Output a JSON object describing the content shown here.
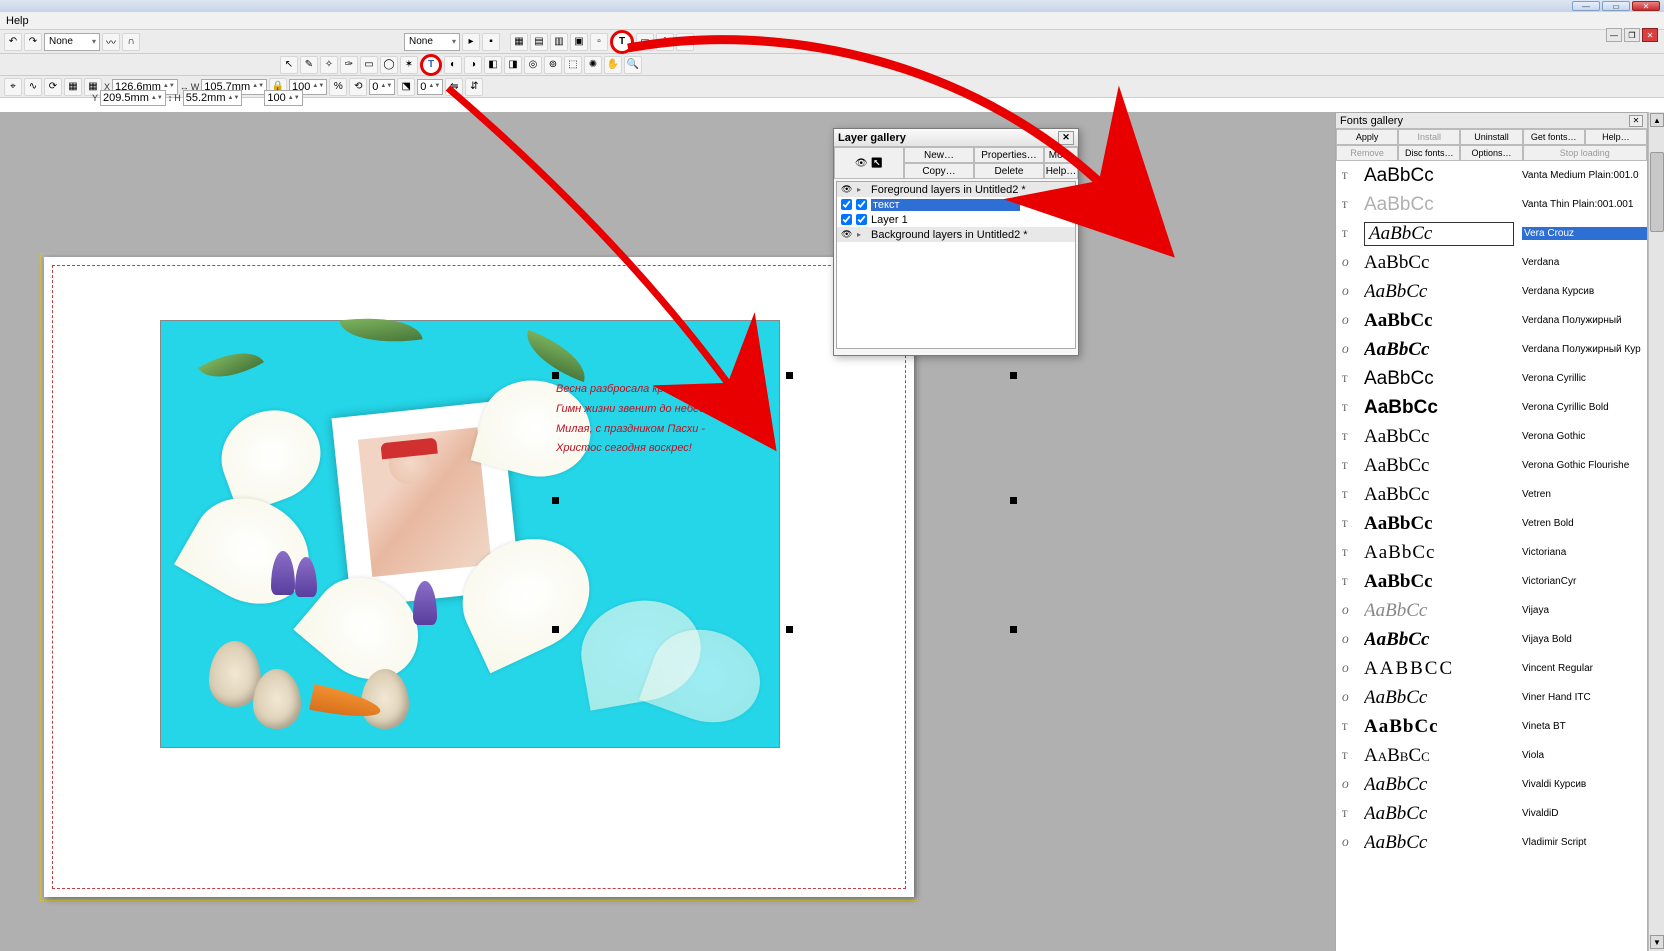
{
  "window": {
    "title": " "
  },
  "menubar": {
    "help": "Help"
  },
  "toolbar1": {
    "none1": "None",
    "none2": "None"
  },
  "geom": {
    "x_label": "X",
    "y_label": "Y",
    "w_label": "W",
    "h_label": "H",
    "x": "126.6mm",
    "y": "209.5mm",
    "w": "105.7mm",
    "h": "55.2mm",
    "pct1": "100",
    "pct2": "100",
    "angle": "0",
    "skew": "0"
  },
  "poem": {
    "l1": "Весна разбросала краски,",
    "l2": "Гимн жизни звенит до небес,",
    "l3": "Милая, с праздником Пасхи -",
    "l4": "Христос сегодня воскрес!"
  },
  "layer_gallery": {
    "title": "Layer gallery",
    "buttons": {
      "new": "New…",
      "properties": "Properties…",
      "move": "Move",
      "copy": "Copy…",
      "delete": "Delete",
      "help": "Help…"
    },
    "rows": [
      {
        "type": "header",
        "label": "Foreground layers in Untitled2 *"
      },
      {
        "type": "layer",
        "label": "текст",
        "selected": true
      },
      {
        "type": "layer",
        "label": "Layer 1"
      },
      {
        "type": "header",
        "label": "Background layers in Untitled2 *"
      }
    ]
  },
  "fonts_gallery": {
    "title": "Fonts gallery",
    "buttons": {
      "apply": "Apply",
      "install": "Install",
      "uninstall": "Uninstall",
      "getfonts": "Get fonts…",
      "help": "Help…",
      "remove": "Remove",
      "discfonts": "Disc fonts…",
      "options": "Options…",
      "stoploading": "Stop loading"
    },
    "sample": "AaBbCc",
    "fonts": [
      {
        "ico": "T",
        "prev_style": "font-family:Arial;",
        "name": "Vanta Medium Plain:001.0"
      },
      {
        "ico": "T",
        "prev_style": "font-family:Arial;color:#b0b0b0;",
        "name": "Vanta Thin Plain:001.001"
      },
      {
        "ico": "T",
        "prev_style": "font-family:'Brush Script MT',cursive;font-style:italic;",
        "name": "Vera Crouz",
        "selected": true
      },
      {
        "ico": "O",
        "prev_style": "font-family:Verdana;",
        "name": "Verdana"
      },
      {
        "ico": "O",
        "prev_style": "font-family:Verdana;font-style:italic;",
        "name": "Verdana Курсив"
      },
      {
        "ico": "O",
        "prev_style": "font-family:Verdana;font-weight:bold;",
        "name": "Verdana Полужирный"
      },
      {
        "ico": "O",
        "prev_style": "font-family:Verdana;font-weight:bold;font-style:italic;",
        "name": "Verdana Полужирный Кур"
      },
      {
        "ico": "T",
        "prev_style": "font-family:Arial;",
        "name": "Verona Cyrillic"
      },
      {
        "ico": "T",
        "prev_style": "font-family:Arial;font-weight:bold;",
        "name": "Verona Cyrillic Bold"
      },
      {
        "ico": "T",
        "prev_style": "font-family:'Old English Text MT',serif;",
        "name": "Verona Gothic"
      },
      {
        "ico": "T",
        "prev_style": "font-family:'Old English Text MT',serif;",
        "name": "Verona Gothic Flourishe"
      },
      {
        "ico": "T",
        "prev_style": "font-family:'Times New Roman',serif;",
        "name": "Vetren"
      },
      {
        "ico": "T",
        "prev_style": "font-family:'Times New Roman',serif;font-weight:bold;",
        "name": "Vetren Bold"
      },
      {
        "ico": "T",
        "prev_style": "font-family:'Wide Latin',serif;letter-spacing:1px;",
        "name": "Victoriana"
      },
      {
        "ico": "T",
        "prev_style": "font-family:'Cooper Black',serif;font-weight:bold;",
        "name": "VictorianCyr"
      },
      {
        "ico": "O",
        "prev_style": "font-family:Georgia;font-style:italic;color:#888;",
        "name": "Vijaya"
      },
      {
        "ico": "O",
        "prev_style": "font-family:Georgia;font-style:italic;font-weight:bold;",
        "name": "Vijaya Bold"
      },
      {
        "ico": "O",
        "prev_style": "font-family:'Arial Narrow';letter-spacing:2px;text-transform:uppercase;",
        "sample": "AABBCC",
        "name": "Vincent Regular"
      },
      {
        "ico": "O",
        "prev_style": "font-family:'Segoe Script',cursive;font-style:italic;",
        "name": "Viner Hand ITC"
      },
      {
        "ico": "T",
        "prev_style": "font-family:'Stencil',serif;font-weight:900;letter-spacing:1px;",
        "name": "Vineta BT"
      },
      {
        "ico": "T",
        "prev_style": "font-family:'Times New Roman',serif;font-variant:small-caps;",
        "name": "Viola"
      },
      {
        "ico": "O",
        "prev_style": "font-family:'Brush Script MT',cursive;font-style:italic;",
        "name": "Vivaldi Курсив"
      },
      {
        "ico": "T",
        "prev_style": "font-family:'Segoe Script',cursive;font-style:italic;",
        "name": "VivaldiD"
      },
      {
        "ico": "O",
        "prev_style": "font-family:'Segoe Script',cursive;font-style:italic;",
        "name": "Vladimir Script"
      }
    ]
  }
}
